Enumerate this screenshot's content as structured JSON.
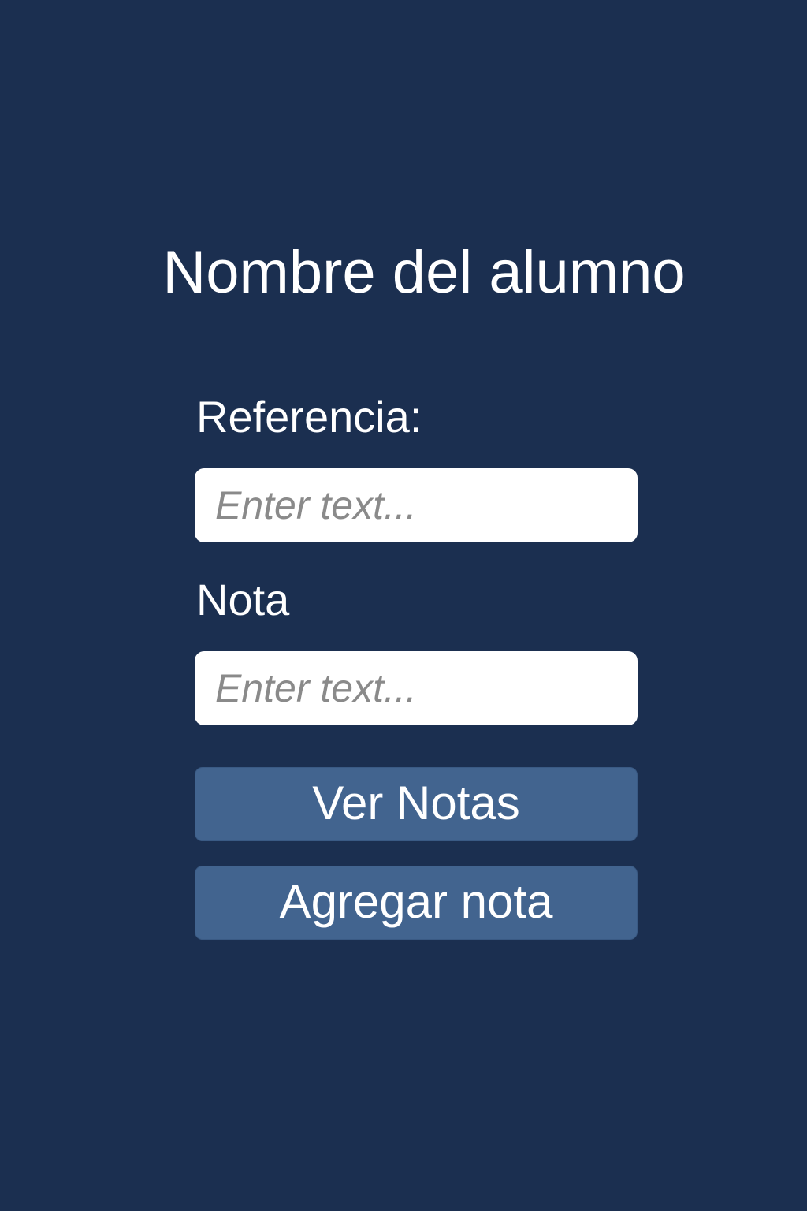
{
  "screen": {
    "title": "Nombre del alumno",
    "background_color": "#1b2f50",
    "accent_button_color": "#42648f"
  },
  "form": {
    "reference_label": "Referencia:",
    "reference_input": {
      "value": "",
      "placeholder": "Enter text..."
    },
    "grade_label": "Nota",
    "grade_input": {
      "value": "",
      "placeholder": "Enter text..."
    }
  },
  "actions": {
    "view_grades_label": "Ver Notas",
    "add_grade_label": "Agregar nota"
  }
}
